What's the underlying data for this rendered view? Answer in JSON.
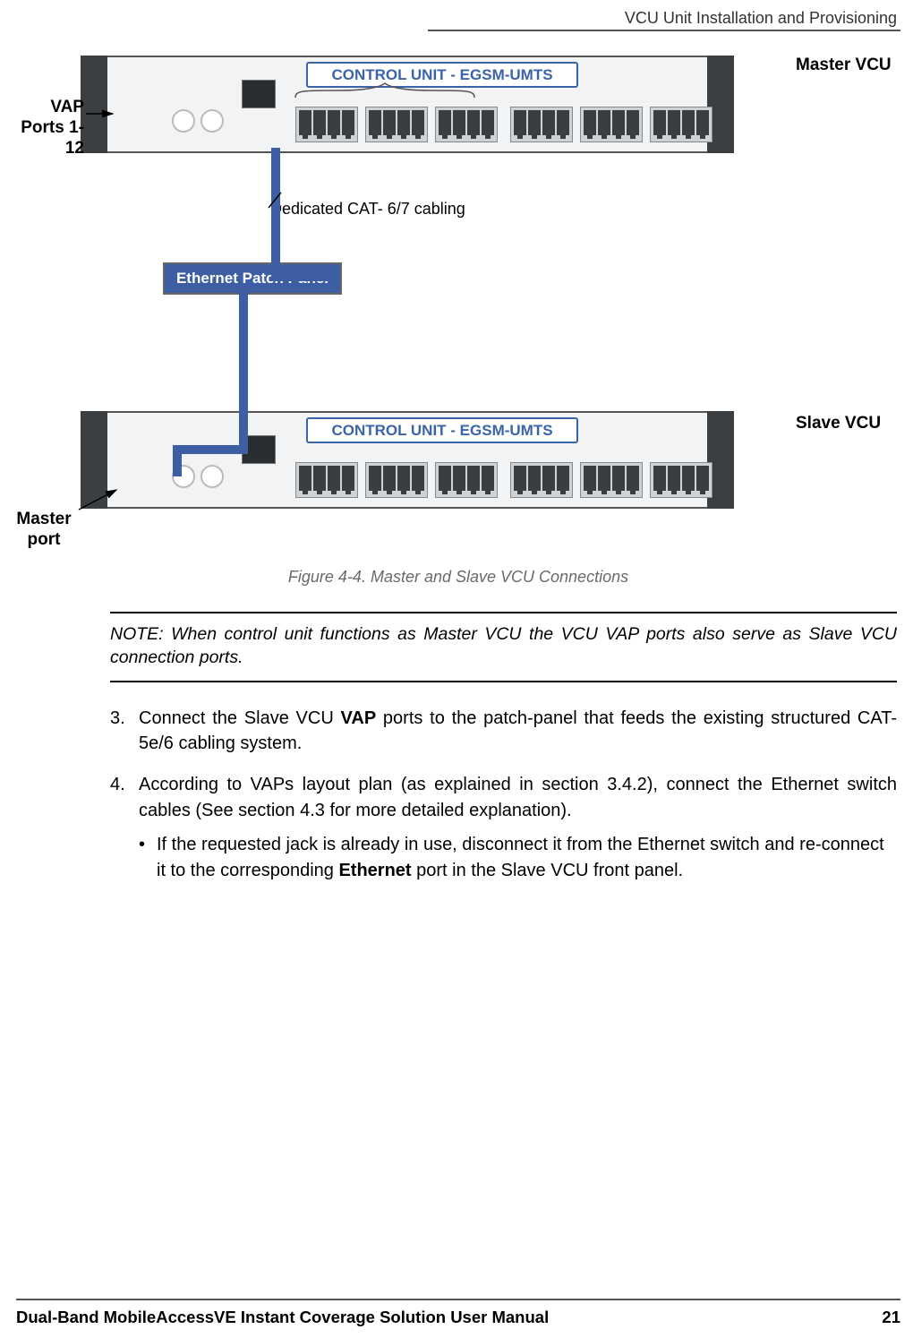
{
  "section_header": "VCU Unit Installation and Provisioning",
  "figure": {
    "unit_title": "CONTROL UNIT - EGSM-UMTS",
    "annot_vap_ports": "VAP Ports 1-12",
    "annot_master_vcu": "Master VCU",
    "annot_slave_vcu": "Slave VCU",
    "annot_master_port": "Master port",
    "annot_dedicated": "Dedicated CAT- 6/7 cabling",
    "annot_patch_panel": "Ethernet Patch Panel",
    "caption": "Figure 4-4. Master and Slave VCU Connections"
  },
  "note": "NOTE: When control unit functions as Master VCU the VCU VAP ports also serve as Slave VCU connection ports.",
  "steps": [
    {
      "number": "3.",
      "pre": "Connect the Slave VCU ",
      "bold": "VAP",
      "post": " ports to the patch-panel that feeds the existing structured CAT-5e/6 cabling system."
    },
    {
      "number": "4.",
      "pre": "According to VAPs layout plan (as explained in section 3.4.2), connect the Ethernet switch cables (See section 4.3 for more detailed explanation).",
      "bold": "",
      "post": ""
    }
  ],
  "bullet": {
    "pre": "If the requested jack is already in use, disconnect it from the Ethernet switch and re-connect it to the corresponding ",
    "bold": "Ethernet",
    "post": " port in the Slave VCU front panel."
  },
  "footer": {
    "manual": "Dual-Band MobileAccessVE Instant Coverage Solution User Manual",
    "page": "21"
  }
}
